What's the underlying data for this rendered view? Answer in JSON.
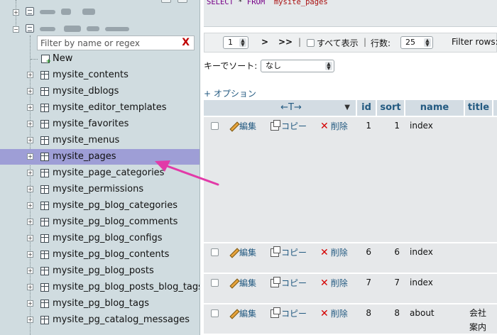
{
  "sql": {
    "select": "SELECT",
    "star": " * ",
    "from": "FROM",
    "table": "`mysite_pages`"
  },
  "nav": {
    "filter_placeholder": "Filter by name or regex",
    "filter_clear": "X",
    "new_label": "New",
    "tables": [
      "mysite_contents",
      "mysite_dblogs",
      "mysite_editor_templates",
      "mysite_favorites",
      "mysite_menus",
      "mysite_pages",
      "mysite_page_categories",
      "mysite_permissions",
      "mysite_pg_blog_categories",
      "mysite_pg_blog_comments",
      "mysite_pg_blog_configs",
      "mysite_pg_blog_contents",
      "mysite_pg_blog_posts",
      "mysite_pg_blog_posts_blog_tags",
      "mysite_pg_blog_tags",
      "mysite_pg_catalog_messages"
    ],
    "selected_table": "mysite_pages"
  },
  "navbar": {
    "page_value": "1",
    "next": ">",
    "last": ">>",
    "separator": "|",
    "show_all": "すべて表示",
    "separator2": "|",
    "rows_label": "行数:",
    "rows_value": "25",
    "filter_rows_label": "Filter rows:"
  },
  "sort": {
    "label": "キーでソート:",
    "value": "なし"
  },
  "options_link": "+ オプション",
  "grid": {
    "header_arrows": "←T→",
    "header_sort_icon": "▼",
    "columns": [
      "id",
      "sort",
      "name",
      "title"
    ],
    "actions": {
      "edit": "編集",
      "copy": "コピー",
      "delete": "削除"
    },
    "rows": [
      {
        "id": "1",
        "sort": "1",
        "name": "index",
        "title": ""
      },
      {
        "id": "6",
        "sort": "6",
        "name": "index",
        "title": ""
      },
      {
        "id": "7",
        "sort": "7",
        "name": "index",
        "title": ""
      },
      {
        "id": "8",
        "sort": "8",
        "name": "about",
        "title": "会社\n案内"
      }
    ]
  },
  "colors": {
    "nav_bg": "#d0dce0",
    "selected_row": "#9e9ed6",
    "link": "#235a81",
    "header_cell": "#d3dce3",
    "row_cell": "#e6e8ea",
    "arrow": "#e23aa8"
  },
  "icons": [
    "database-icon",
    "table-icon",
    "new-table-icon",
    "pencil-icon",
    "copy-icon",
    "delete-icon",
    "expand-icon"
  ]
}
